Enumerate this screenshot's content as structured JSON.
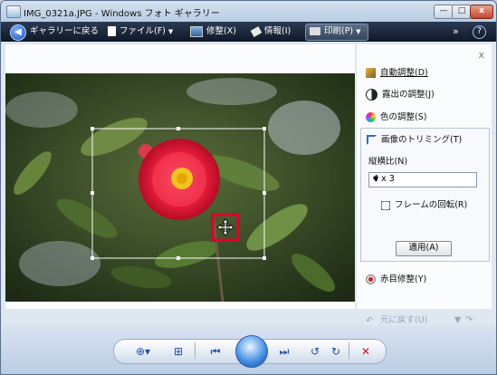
{
  "window": {
    "title": "IMG_0321a.JPG - Windows フォト ギャラリー",
    "min_glyph": "—",
    "max_glyph": "□",
    "close_glyph": "x"
  },
  "toolbar": {
    "back_label": "ギャラリーに戻る",
    "file_label": "ファイル(F)",
    "fix_label": "修整(X)",
    "info_label": "情報(I)",
    "print_label": "印刷(P)",
    "more_glyph": "»",
    "help_glyph": "?"
  },
  "panel": {
    "close_glyph": "x",
    "auto_adjust": "自動調整(D)",
    "exposure": "露出の調整(J)",
    "color": "色の調整(S)",
    "trim": "画像のトリミング(T)",
    "aspect_label": "縦横比(N)",
    "aspect_value": "4 x 3",
    "rotate_frame": "フレームの回転(R)",
    "apply": "適用(A)",
    "redeye": "赤目修整(Y)",
    "undo": "元に戻す(U)"
  },
  "colors": {
    "toolbar_bg": "#0f1827",
    "accent": "#1f4fa6",
    "highlight": "#e0002a"
  }
}
